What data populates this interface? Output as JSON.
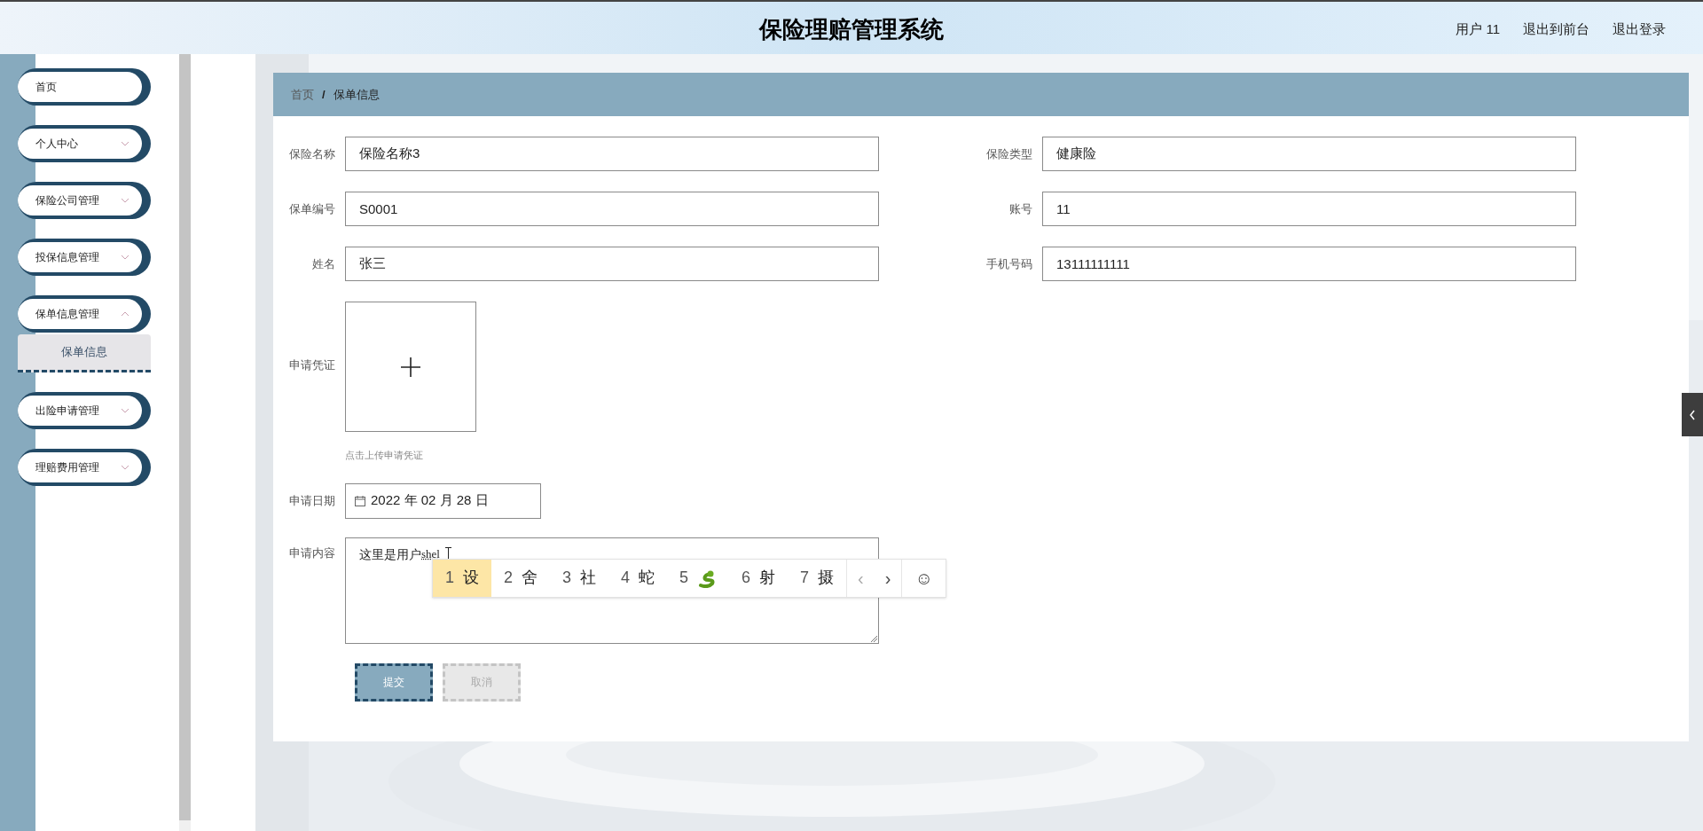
{
  "header": {
    "title": "保险理赔管理系统",
    "links": [
      "用户 11",
      "退出到前台",
      "退出登录"
    ]
  },
  "sidebar": {
    "items": [
      {
        "label": "首页",
        "kind": "link"
      },
      {
        "label": "个人中心",
        "kind": "menu",
        "expanded": false
      },
      {
        "label": "保险公司管理",
        "kind": "menu",
        "expanded": false
      },
      {
        "label": "投保信息管理",
        "kind": "menu",
        "expanded": false
      },
      {
        "label": "保单信息管理",
        "kind": "menu",
        "expanded": true,
        "children": [
          {
            "label": "保单信息",
            "selected": true
          }
        ]
      },
      {
        "label": "出险申请管理",
        "kind": "menu",
        "expanded": false
      },
      {
        "label": "理赔费用管理",
        "kind": "menu",
        "expanded": false
      }
    ]
  },
  "breadcrumb": {
    "items": [
      "首页",
      "保单信息"
    ],
    "separator": "/"
  },
  "form": {
    "rows": [
      [
        {
          "label": "保险名称",
          "value": "保险名称3"
        },
        {
          "label": "保险类型",
          "value": "健康险"
        }
      ],
      [
        {
          "label": "保单编号",
          "value": "S0001"
        },
        {
          "label": "账号",
          "value": "11"
        }
      ],
      [
        {
          "label": "姓名",
          "value": "张三"
        },
        {
          "label": "手机号码",
          "value": "13111111111"
        }
      ]
    ],
    "upload": {
      "label": "申请凭证",
      "hint": "点击上传申请凭证"
    },
    "date": {
      "label": "申请日期",
      "value": "2022 年 02 月 28 日"
    },
    "content": {
      "label": "申请内容",
      "value": "这里是用户",
      "composition": "shel"
    },
    "buttons": [
      {
        "label": "提交",
        "kind": "primary"
      },
      {
        "label": "取消",
        "kind": "secondary"
      }
    ]
  },
  "ime": {
    "candidates": [
      {
        "number": "1",
        "text": "设",
        "kind": "text",
        "selected": true
      },
      {
        "number": "2",
        "text": "舍",
        "kind": "text",
        "selected": false
      },
      {
        "number": "3",
        "text": "社",
        "kind": "text",
        "selected": false
      },
      {
        "number": "4",
        "text": "蛇",
        "kind": "text",
        "selected": false
      },
      {
        "number": "5",
        "kind": "icon",
        "selected": false
      },
      {
        "number": "6",
        "text": "射",
        "kind": "text",
        "selected": false
      },
      {
        "number": "7",
        "text": "摄",
        "kind": "text",
        "selected": false
      }
    ],
    "prev": "‹",
    "next": "›",
    "emoji": "☺"
  }
}
